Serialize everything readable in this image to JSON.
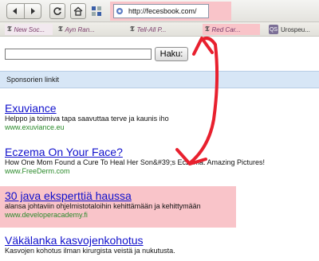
{
  "browser": {
    "url": "http://fecesbook.com/",
    "nav_buttons": [
      "back",
      "forward"
    ]
  },
  "bookmarks": [
    {
      "label": "New Soc...",
      "icon": "nyt-icon"
    },
    {
      "label": "Ayn Ran...",
      "icon": "nyt-icon"
    },
    {
      "label": "Tell-All P...",
      "icon": "nyt-icon"
    },
    {
      "label": "Red Car...",
      "icon": "nyt-icon"
    },
    {
      "label": "Urospeu...",
      "icon": "qs-icon",
      "icon_text": "QS"
    }
  ],
  "search": {
    "value": "",
    "button_label": "Haku:"
  },
  "sponsored": {
    "header": "Sponsorien linkit"
  },
  "ads": [
    {
      "title": "Exuviance",
      "description": "Helppo ja toimiva tapa saavuttaa terve ja kaunis iho",
      "url": "www.exuviance.eu"
    },
    {
      "title": "Eczema On Your Face?",
      "description": "How One Mom Found a Cure To Heal Her Son&#39;s Eczema. Amazing Pictures!",
      "url": "www.FreeDerm.com"
    },
    {
      "title": "30 java eksperttiä haussa",
      "description": "alansa johtaviin ohjelmistotaloihin kehittämään ja kehittymään",
      "url": "www.developeracademy.fi"
    },
    {
      "title": "Väkälanka kasvojenkohotus",
      "description": "Kasvojen kohotus ilman kirurgista veistä ja nukutusta.",
      "url": ""
    }
  ],
  "colors": {
    "highlight": "#f9c4c9",
    "annotation": "#e8202e",
    "ad_title": "#1010cc",
    "ad_url": "#2a8a2a",
    "sponsored_bg": "#d7e6f6"
  }
}
